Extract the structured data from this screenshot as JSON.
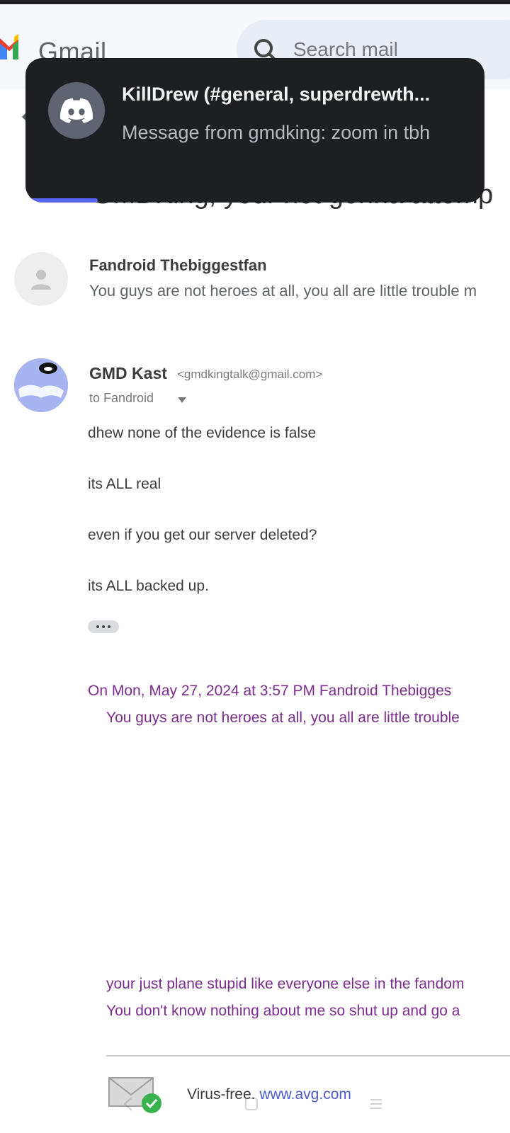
{
  "gmail": {
    "brand": "Gmail",
    "search_placeholder": "Search mail",
    "subject_partial": "GMDKing, your not gonna attemp"
  },
  "notification": {
    "app_icon": "discord-icon",
    "title": "KillDrew (#general, superdrewth...",
    "body": "Message from gmdking: zoom in tbh",
    "accent": "#5865f2"
  },
  "thread": {
    "message1": {
      "sender": "Fandroid Thebiggestfan",
      "snippet": "You guys are not heroes at all, you all are little trouble m"
    },
    "message2": {
      "sender": "GMD Kast",
      "email": "<gmdkingtalk@gmail.com>",
      "to_label": "to Fandroid",
      "body": [
        "dhew none of the evidence is false",
        "its ALL real",
        "even if you get our server deleted?",
        "its ALL backed up."
      ],
      "quote_header": "On Mon, May 27, 2024 at 3:57 PM Fandroid Thebigges",
      "quote_body": "You guys are not heroes at all, you all are little trouble",
      "reply_lines": [
        "your just plane stupid like everyone else in the fandom",
        "You don't know nothing about me so shut up and go a"
      ],
      "footer_prefix": "Virus-free.",
      "footer_link": "www.avg.com"
    }
  }
}
